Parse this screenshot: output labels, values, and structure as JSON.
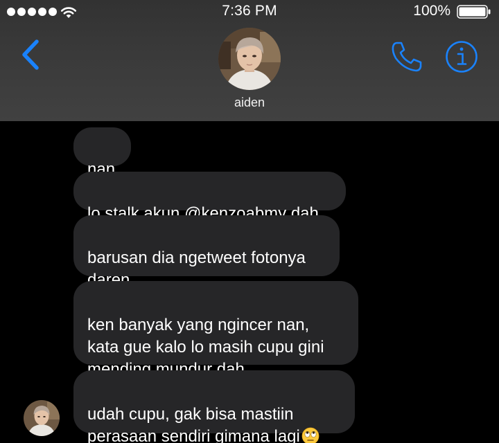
{
  "status_bar": {
    "signal_icon": "signal-dots-icon",
    "wifi_icon": "wifi-icon",
    "time": "7:36 PM",
    "battery_percent": "100%",
    "battery_icon": "battery-full-icon"
  },
  "header": {
    "back_icon": "chevron-left-icon",
    "contact_name": "aiden",
    "call_icon": "phone-icon",
    "info_icon": "info-icon",
    "accent_color": "#1a82fb",
    "background_color": "#3a3a3a"
  },
  "messages": [
    {
      "sender": "aiden",
      "text": "nan"
    },
    {
      "sender": "aiden",
      "text": "lo stalk akun @kenzoabmy dah"
    },
    {
      "sender": "aiden",
      "text": "barusan dia ngetweet fotonya\ndaren"
    },
    {
      "sender": "aiden",
      "text": "ken banyak yang ngincer nan,\nkata gue kalo lo masih cupu gini\nmending mundur dah"
    },
    {
      "sender": "aiden",
      "text": "udah cupu, gak bisa mastiin\nperasaan sendiri gimana lagi",
      "emoji": "face-with-rolling-eyes-emoji"
    }
  ],
  "thread": {
    "bubble_color": "#262628",
    "background_color": "#000000"
  }
}
